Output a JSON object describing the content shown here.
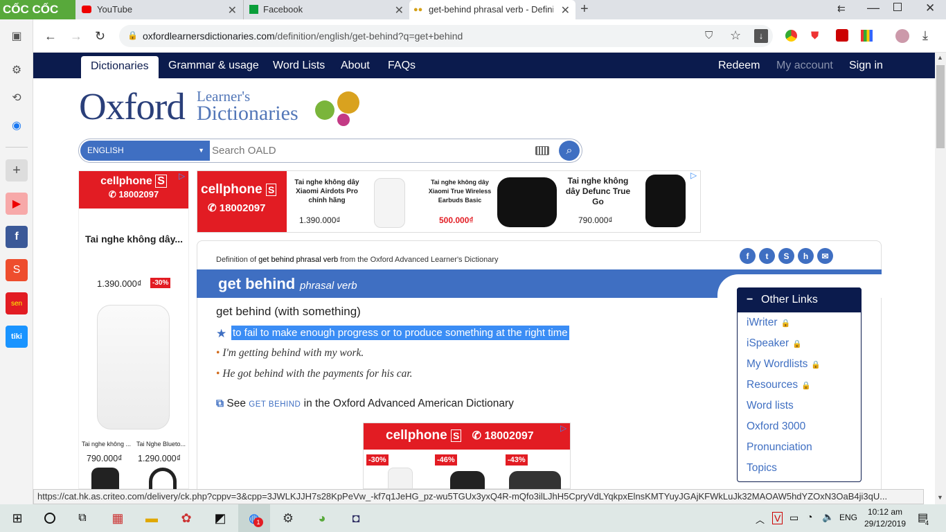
{
  "browser": {
    "brand": "CỐC CỐC",
    "tabs": [
      {
        "title": "YouTube"
      },
      {
        "title": "Facebook"
      },
      {
        "title": "get-behind phrasal verb - Definitio"
      }
    ],
    "url_domain": "oxfordlearnersdictionaries.com",
    "url_path": "/definition/english/get-behind?q=get+behind",
    "status_url": "https://cat.hk.as.criteo.com/delivery/ck.php?cppv=3&cpp=3JWLKJJH7s28KpPeVw_-kf7q1JeHG_pz-wu5TGUx3yxQ4R-mQfo3ilLJhH5CpryVdLYqkpxElnsKMTYuyJGAjKFWkLuJk32MAOAW5hdYZOxN3OaB4ji3qU..."
  },
  "site_nav": {
    "items": [
      "Dictionaries",
      "Grammar & usage",
      "Word Lists",
      "About",
      "FAQs"
    ],
    "right": [
      "Redeem",
      "My account",
      "Sign in"
    ]
  },
  "logo": {
    "oxford": "Oxford",
    "learners": "Learner's",
    "dictionaries": "Dictionaries"
  },
  "search": {
    "language": "ENGLISH",
    "placeholder": "Search OALD"
  },
  "ads": {
    "brand": "cellphone",
    "phone": "18002097",
    "left_title": "Tai nghe không dây...",
    "left_price": "1.390.000₫",
    "left_discount": "-30%",
    "left_small1": "Tai nghe không ...",
    "left_small2": "Tai Nghe Blueto...",
    "left_price1": "790.000₫",
    "left_price2": "1.290.000₫",
    "top_p1_name": "Tai nghe không dây Xiaomi Airdots Pro chính hãng",
    "top_p1_price": "1.390.000₫",
    "top_p2_name": "Tai nghe không dây Xiaomi True Wireless Earbuds Basic",
    "top_p2_price": "500.000₫",
    "top_p3_name": "Tai nghe không dây Defunc True Go",
    "top_p3_price": "790.000₫",
    "bottom_d1": "-30%",
    "bottom_d2": "-46%",
    "bottom_d3": "-43%"
  },
  "entry": {
    "source_prefix": "Definition of ",
    "source_word": "get behind phrasal verb",
    "source_suffix": " from the Oxford Advanced Learner's Dictionary",
    "headword": "get behind",
    "pos": "phrasal verb",
    "sense_head": "get behind (with something)",
    "definition": "to fail to make enough progress or to produce something at the right time",
    "examples": [
      "I'm getting behind with my work.",
      "He got behind with the payments for his car."
    ],
    "see_prefix": "See ",
    "see_word": "GET BEHIND",
    "see_suffix": " in the Oxford Advanced American Dictionary"
  },
  "other_links": {
    "title": "Other Links",
    "items": [
      {
        "label": "iWriter",
        "locked": true
      },
      {
        "label": "iSpeaker",
        "locked": true
      },
      {
        "label": "My Wordlists",
        "locked": true
      },
      {
        "label": "Resources",
        "locked": true
      },
      {
        "label": "Word lists",
        "locked": false
      },
      {
        "label": "Oxford 3000",
        "locked": false
      },
      {
        "label": "Pronunciation",
        "locked": false
      },
      {
        "label": "Topics",
        "locked": false
      }
    ]
  },
  "taskbar": {
    "lang": "ENG",
    "time": "10:12 am",
    "date": "29/12/2019",
    "notif_count": "4",
    "zalo_badge": "1"
  }
}
